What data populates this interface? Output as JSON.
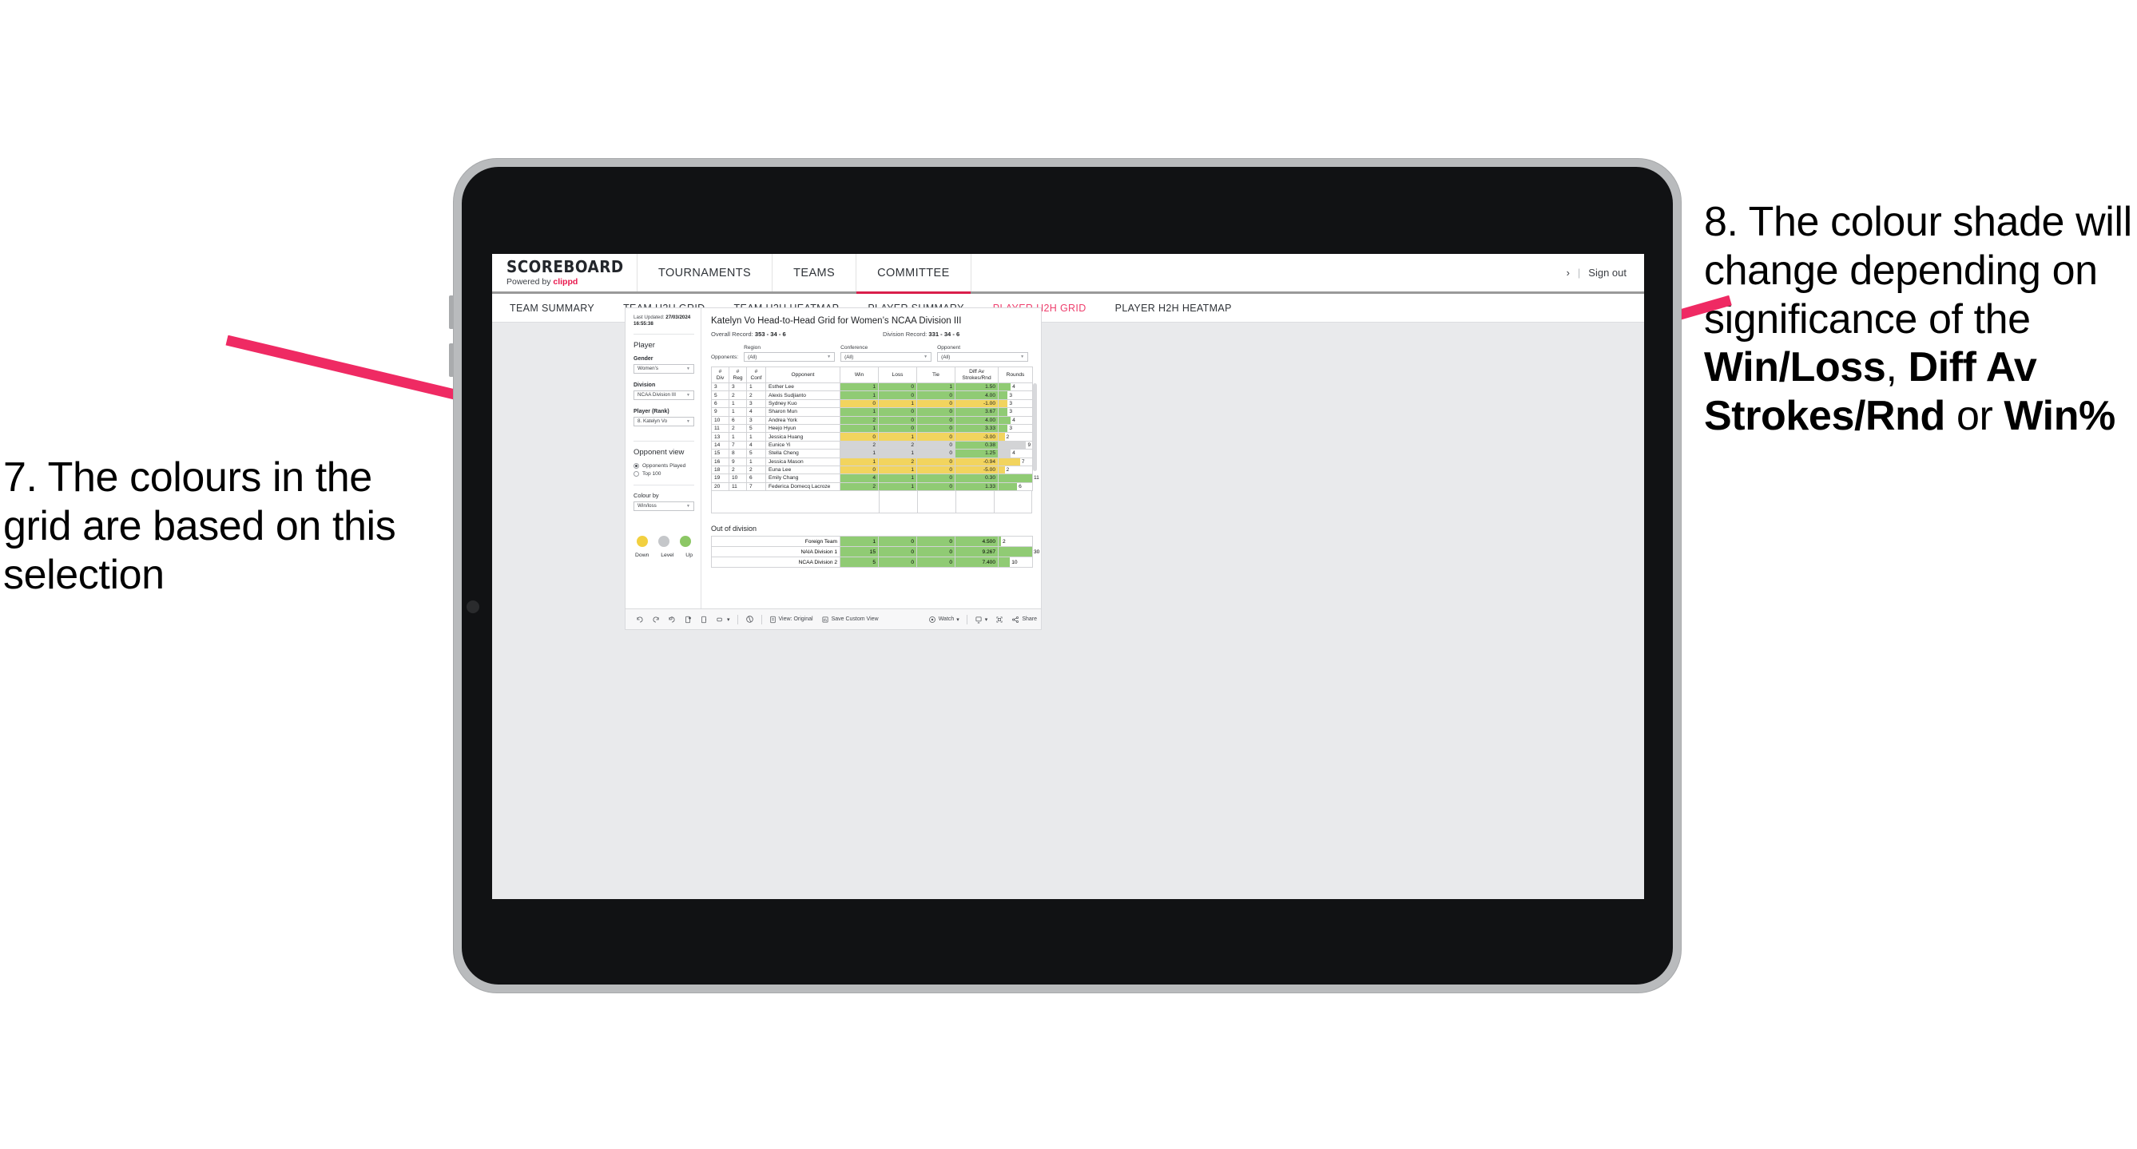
{
  "annotations": {
    "left": "7. The colours in the grid are based on this selection",
    "right_pre": "8. The colour shade will change depending on significance of the ",
    "right_b1": "Win/Loss",
    "right_mid1": ", ",
    "right_b2": "Diff Av Strokes/Rnd",
    "right_mid2": " or ",
    "right_b3": "Win%",
    "arrow_color": "#ef2a63"
  },
  "header": {
    "brand_title": "SCOREBOARD",
    "brand_powered": "Powered by ",
    "brand_name": "clippd",
    "nav": [
      {
        "label": "TOURNAMENTS",
        "active": false
      },
      {
        "label": "TEAMS",
        "active": false
      },
      {
        "label": "COMMITTEE",
        "active": true
      }
    ],
    "chevron": "›",
    "divider": "|",
    "sign_out": "Sign out"
  },
  "subnav": [
    {
      "label": "TEAM SUMMARY",
      "active": false
    },
    {
      "label": "TEAM H2H GRID",
      "active": false
    },
    {
      "label": "TEAM H2H HEATMAP",
      "active": false
    },
    {
      "label": "PLAYER SUMMARY",
      "active": false
    },
    {
      "label": "PLAYER H2H GRID",
      "active": true
    },
    {
      "label": "PLAYER H2H HEATMAP",
      "active": false
    }
  ],
  "filter_pane": {
    "last_updated_label": "Last Updated: ",
    "last_updated_value": "27/03/2024 16:55:38",
    "section_title": "Player",
    "fields": [
      {
        "label": "Gender",
        "value": "Women’s"
      },
      {
        "label": "Division",
        "value": "NCAA Division III"
      },
      {
        "label": "Player (Rank)",
        "value": "8. Katelyn Vo"
      }
    ],
    "opponent_view_title": "Opponent view",
    "opponent_view_options": [
      {
        "label": "Opponents Played",
        "selected": true
      },
      {
        "label": "Top 100",
        "selected": false
      }
    ],
    "colour_by_label": "Colour by",
    "colour_by_value": "Win/loss",
    "legend": [
      {
        "label": "Down",
        "color": "#f2d040"
      },
      {
        "label": "Level",
        "color": "#c5c7ca"
      },
      {
        "label": "Up",
        "color": "#8cc765"
      }
    ]
  },
  "viz": {
    "title": "Katelyn Vo Head-to-Head Grid for Women’s NCAA Division III",
    "overall_record_label": "Overall Record: ",
    "overall_record_value": "353 -  34 - 6",
    "division_record_label": "Division Record: ",
    "division_record_value": "331 -  34 - 6",
    "opponents_label": "Opponents:",
    "opponent_filters": [
      {
        "label": "Region",
        "value": "(All)"
      },
      {
        "label": "Conference",
        "value": "(All)"
      },
      {
        "label": "Opponent",
        "value": "(All)"
      }
    ]
  },
  "chart_data": {
    "type": "table",
    "title": "Katelyn Vo Head-to-Head Grid for Women’s NCAA Division III",
    "columns": [
      "# Div",
      "# Reg",
      "# Conf",
      "Opponent",
      "Win",
      "Loss",
      "Tie",
      "Diff Av Strokes/Rnd",
      "Rounds"
    ],
    "rows": [
      {
        "div": "3",
        "reg": "3",
        "conf": "1",
        "opponent": "Esther Lee",
        "win": "1",
        "loss": "0",
        "tie": "1",
        "diff": "1.50",
        "rounds": "4",
        "color": "#90cb74",
        "bar_pct": 36
      },
      {
        "div": "5",
        "reg": "2",
        "conf": "2",
        "opponent": "Alexis Sudjianto",
        "win": "1",
        "loss": "0",
        "tie": "0",
        "diff": "4.00",
        "rounds": "3",
        "color": "#90cb74",
        "bar_pct": 27
      },
      {
        "div": "6",
        "reg": "1",
        "conf": "3",
        "opponent": "Sydney Kuo",
        "win": "0",
        "loss": "1",
        "tie": "0",
        "diff": "-1.00",
        "rounds": "3",
        "color": "#f2d45e",
        "bar_pct": 27
      },
      {
        "div": "9",
        "reg": "1",
        "conf": "4",
        "opponent": "Sharon Mun",
        "win": "1",
        "loss": "0",
        "tie": "0",
        "diff": "3.67",
        "rounds": "3",
        "color": "#90cb74",
        "bar_pct": 27
      },
      {
        "div": "10",
        "reg": "6",
        "conf": "3",
        "opponent": "Andrea York",
        "win": "2",
        "loss": "0",
        "tie": "0",
        "diff": "4.00",
        "rounds": "4",
        "color": "#90cb74",
        "bar_pct": 36
      },
      {
        "div": "11",
        "reg": "2",
        "conf": "5",
        "opponent": "Heejo Hyun",
        "win": "1",
        "loss": "0",
        "tie": "0",
        "diff": "3.33",
        "rounds": "3",
        "color": "#90cb74",
        "bar_pct": 27
      },
      {
        "div": "13",
        "reg": "1",
        "conf": "1",
        "opponent": "Jessica Huang",
        "win": "0",
        "loss": "1",
        "tie": "0",
        "diff": "-3.00",
        "rounds": "2",
        "color": "#f2d45e",
        "bar_pct": 18
      },
      {
        "div": "14",
        "reg": "7",
        "conf": "4",
        "opponent": "Eunice Yi",
        "win": "2",
        "loss": "2",
        "tie": "0",
        "diff": "0.38",
        "rounds": "9",
        "color": "#d3d4d6",
        "diff_color": "#90cb74",
        "bar_pct": 82
      },
      {
        "div": "15",
        "reg": "8",
        "conf": "5",
        "opponent": "Stella Cheng",
        "win": "1",
        "loss": "1",
        "tie": "0",
        "diff": "1.25",
        "rounds": "4",
        "color": "#d3d4d6",
        "diff_color": "#90cb74",
        "bar_pct": 36
      },
      {
        "div": "16",
        "reg": "9",
        "conf": "1",
        "opponent": "Jessica Mason",
        "win": "1",
        "loss": "2",
        "tie": "0",
        "diff": "-0.94",
        "rounds": "7",
        "color": "#f2d45e",
        "bar_pct": 64
      },
      {
        "div": "18",
        "reg": "2",
        "conf": "2",
        "opponent": "Euna Lee",
        "win": "0",
        "loss": "1",
        "tie": "0",
        "diff": "-5.00",
        "rounds": "2",
        "color": "#f2d45e",
        "bar_pct": 18
      },
      {
        "div": "19",
        "reg": "10",
        "conf": "6",
        "opponent": "Emily Chang",
        "win": "4",
        "loss": "1",
        "tie": "0",
        "diff": "0.30",
        "rounds": "11",
        "color": "#90cb74",
        "bar_pct": 100
      },
      {
        "div": "20",
        "reg": "11",
        "conf": "7",
        "opponent": "Federica Domecq Lacroze",
        "win": "2",
        "loss": "1",
        "tie": "0",
        "diff": "1.33",
        "rounds": "6",
        "color": "#90cb74",
        "bar_pct": 55
      }
    ],
    "out_of_division_title": "Out of division",
    "out_of_division": [
      {
        "name": "Foreign Team",
        "win": "1",
        "loss": "0",
        "tie": "0",
        "diff": "4.500",
        "rounds": "2",
        "color": "#90cb74",
        "bar_pct": 7
      },
      {
        "name": "NAIA Division 1",
        "win": "15",
        "loss": "0",
        "tie": "0",
        "diff": "9.267",
        "rounds": "30",
        "color": "#90cb74",
        "bar_pct": 100
      },
      {
        "name": "NCAA Division 2",
        "win": "5",
        "loss": "0",
        "tie": "0",
        "diff": "7.400",
        "rounds": "10",
        "color": "#90cb74",
        "bar_pct": 34
      }
    ]
  },
  "toolbar": {
    "view_original": "View: Original",
    "save_custom_view": "Save Custom View",
    "watch": "Watch",
    "share": "Share",
    "caret": "▾"
  }
}
